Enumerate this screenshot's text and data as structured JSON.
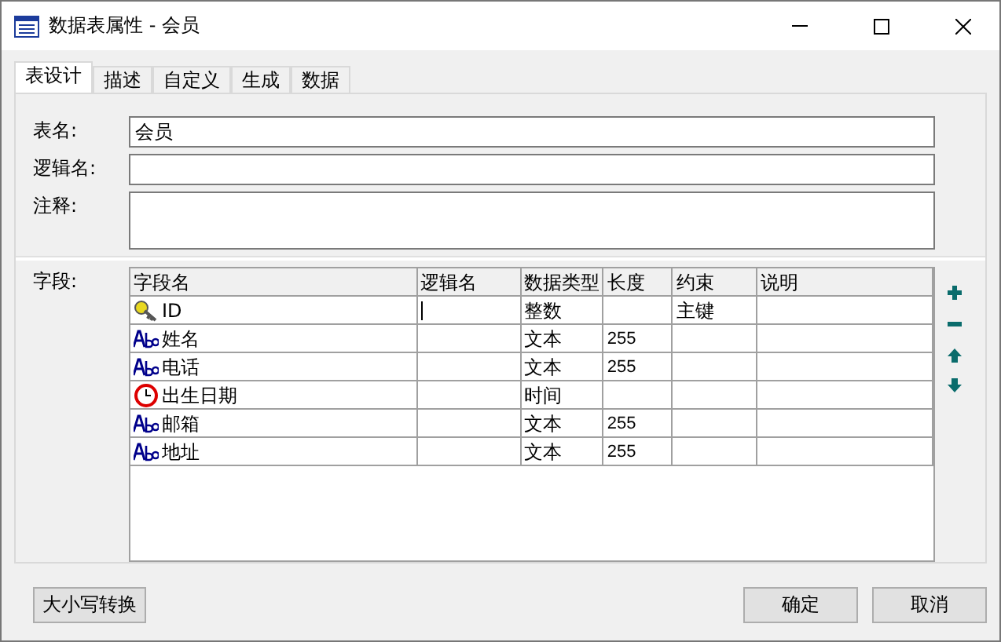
{
  "window": {
    "title": "数据表属性 - 会员"
  },
  "tabs": [
    {
      "label": "表设计",
      "selected": true
    },
    {
      "label": "描述",
      "selected": false
    },
    {
      "label": "自定义",
      "selected": false
    },
    {
      "label": "生成",
      "selected": false
    },
    {
      "label": "数据",
      "selected": false
    }
  ],
  "form": {
    "name_label": "表名:",
    "name_value": "会员",
    "logical_label": "逻辑名:",
    "comment_label": "注释:"
  },
  "fields": {
    "label": "字段:",
    "columns": [
      "字段名",
      "逻辑名",
      "数据类型",
      "长度",
      "约束",
      "说明"
    ],
    "rows": [
      {
        "kind": "key",
        "name": "ID",
        "type": "整数",
        "length": "",
        "constraint": "主键",
        "editing": true
      },
      {
        "kind": "text",
        "name": "姓名",
        "type": "文本",
        "length": "255",
        "constraint": "",
        "editing": false
      },
      {
        "kind": "text",
        "name": "电话",
        "type": "文本",
        "length": "255",
        "constraint": "",
        "editing": false
      },
      {
        "kind": "time",
        "name": "出生日期",
        "type": "时间",
        "length": "",
        "constraint": "",
        "editing": false
      },
      {
        "kind": "text",
        "name": "邮箱",
        "type": "文本",
        "length": "255",
        "constraint": "",
        "editing": false
      },
      {
        "kind": "text",
        "name": "地址",
        "type": "文本",
        "length": "255",
        "constraint": "",
        "editing": false
      }
    ]
  },
  "buttons": {
    "case": "大小写转换",
    "ok": "确定",
    "cancel": "取消"
  }
}
